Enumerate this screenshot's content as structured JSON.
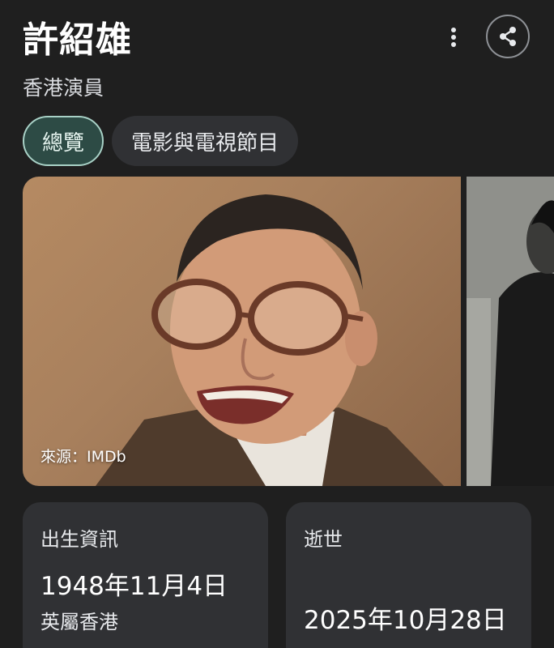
{
  "header": {
    "title": "許紹雄",
    "subtitle": "香港演員",
    "more_icon": "more-vert-icon",
    "share_icon": "share-icon"
  },
  "tabs": [
    {
      "label": "總覽",
      "active": true
    },
    {
      "label": "電影與電視節目",
      "active": false
    }
  ],
  "images": {
    "source_caption": "來源：IMDb"
  },
  "cards": {
    "birth": {
      "label": "出生資訊",
      "date": "1948年11月4日",
      "place": "英屬香港"
    },
    "death": {
      "label": "逝世",
      "date": "2025年10月28日"
    }
  },
  "colors": {
    "background": "#1f1f1f",
    "card": "#303134",
    "active_tab_bg": "#2d4b45",
    "active_tab_border": "#a8d1c6"
  }
}
